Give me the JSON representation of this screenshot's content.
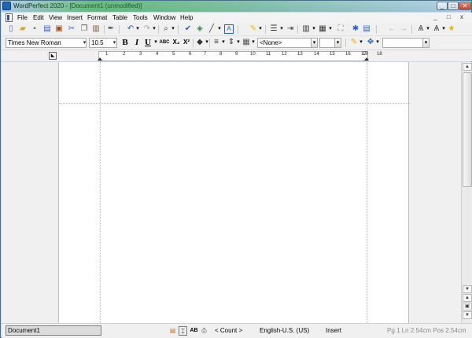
{
  "window": {
    "title": "WordPerfect 2020 - [Document1 (unmodified)]",
    "controls": [
      "_",
      "□",
      "✕"
    ]
  },
  "menu": {
    "items": [
      "File",
      "Edit",
      "View",
      "Insert",
      "Format",
      "Table",
      "Tools",
      "Window",
      "Help"
    ],
    "doc_controls": [
      "_",
      "□",
      "x"
    ]
  },
  "toolbar1": {
    "icons": [
      "new-document",
      "open",
      "save",
      "print",
      "print-preview",
      "cut",
      "copy",
      "paste",
      "undo",
      "redo",
      "zoom",
      "spell-check",
      "clipart",
      "line",
      "text-box",
      "highlight",
      "bullets",
      "columns",
      "table",
      "full-page",
      "asterisk",
      "quickmark",
      "prev",
      "next",
      "text-mode",
      "format-as-you-go",
      "reveal-codes"
    ]
  },
  "propertybar": {
    "font": "Times New Roman",
    "size": "10.5",
    "bold": "B",
    "italic": "I",
    "underline": "U",
    "abc": "ABC",
    "subscript": "X₂",
    "superscript": "X²",
    "style": "<None>",
    "colors": {
      "accent": "#2b5fb3",
      "highlight": "#e8c000"
    }
  },
  "ruler": {
    "numbers": [
      "1",
      "2",
      "3",
      "4",
      "5",
      "6",
      "7",
      "8",
      "9",
      "10",
      "11",
      "12",
      "13",
      "14",
      "15",
      "16",
      "17",
      "18",
      "19"
    ]
  },
  "status": {
    "document": "Document1",
    "count": "< Count >",
    "language": "English-U.S. (US)",
    "mode": "Insert",
    "position": "Pg 1 Ln 2.54cm Pos 2.54cm",
    "ab": "AB"
  }
}
